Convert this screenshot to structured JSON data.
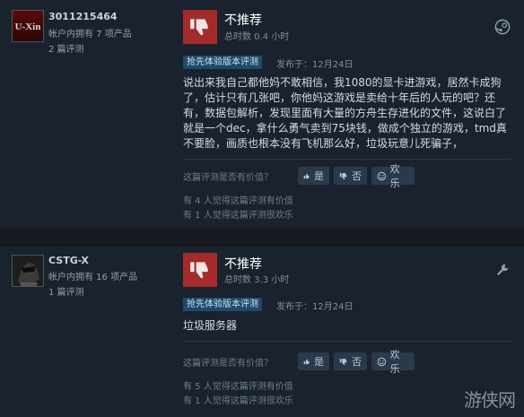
{
  "colors": {
    "page_bg": "#16191f",
    "card_bg": "#1a222d",
    "thumb_down_bg": "#a32b2b",
    "tag_bg": "#1d4a6b",
    "button_bg": "#2a3a4a"
  },
  "reviews": [
    {
      "avatar_text": "U-Xin",
      "username": "3011215464",
      "owned": "帐户内拥有 7 项产品",
      "review_count": "2 篇评测",
      "verdict": "不推荐",
      "hours": "总时数 0.4 小时",
      "early_tag": "抢先体验版本评测",
      "posted": "发布于：12月24日",
      "body": "说出来我自己都他妈不敢相信，我1080的显卡进游戏，居然卡成狗了，估计只有几张吧，你他妈这游戏是卖给十年后的人玩的吧？还有，数据包解析，发现里面有大量的方舟生存进化的文件，这说白了就是一个dec，拿什么勇气卖到75块钱，做成个独立的游戏，tmd真不要脸，画质也根本没有飞机那么好，垃圾玩意儿死骗子，",
      "helpful_question": "这篇评测是否有价值？",
      "yes_label": "是",
      "no_label": "否",
      "funny_label": "欢乐",
      "helpful_stat": "有 4 人觉得这篇评测有价值",
      "funny_stat": "有 1 人觉得这篇评测很欢乐",
      "corner_icon": "steam-icon"
    },
    {
      "avatar_text": "",
      "username": "CSTG-X",
      "owned": "帐户内拥有 16 项产品",
      "review_count": "1 篇评测",
      "verdict": "不推荐",
      "hours": "总时数 3.3 小时",
      "early_tag": "抢先体验版本评测",
      "posted": "发布于：12月24日",
      "body": "垃圾服务器",
      "helpful_question": "这篇评测是否有价值？",
      "yes_label": "是",
      "no_label": "否",
      "funny_label": "欢乐",
      "helpful_stat": "有 5 人觉得这篇评测有价值",
      "funny_stat": "有 1 人觉得这篇评测很欢乐",
      "corner_icon": "wrench-icon"
    }
  ],
  "watermark": "游侠网"
}
